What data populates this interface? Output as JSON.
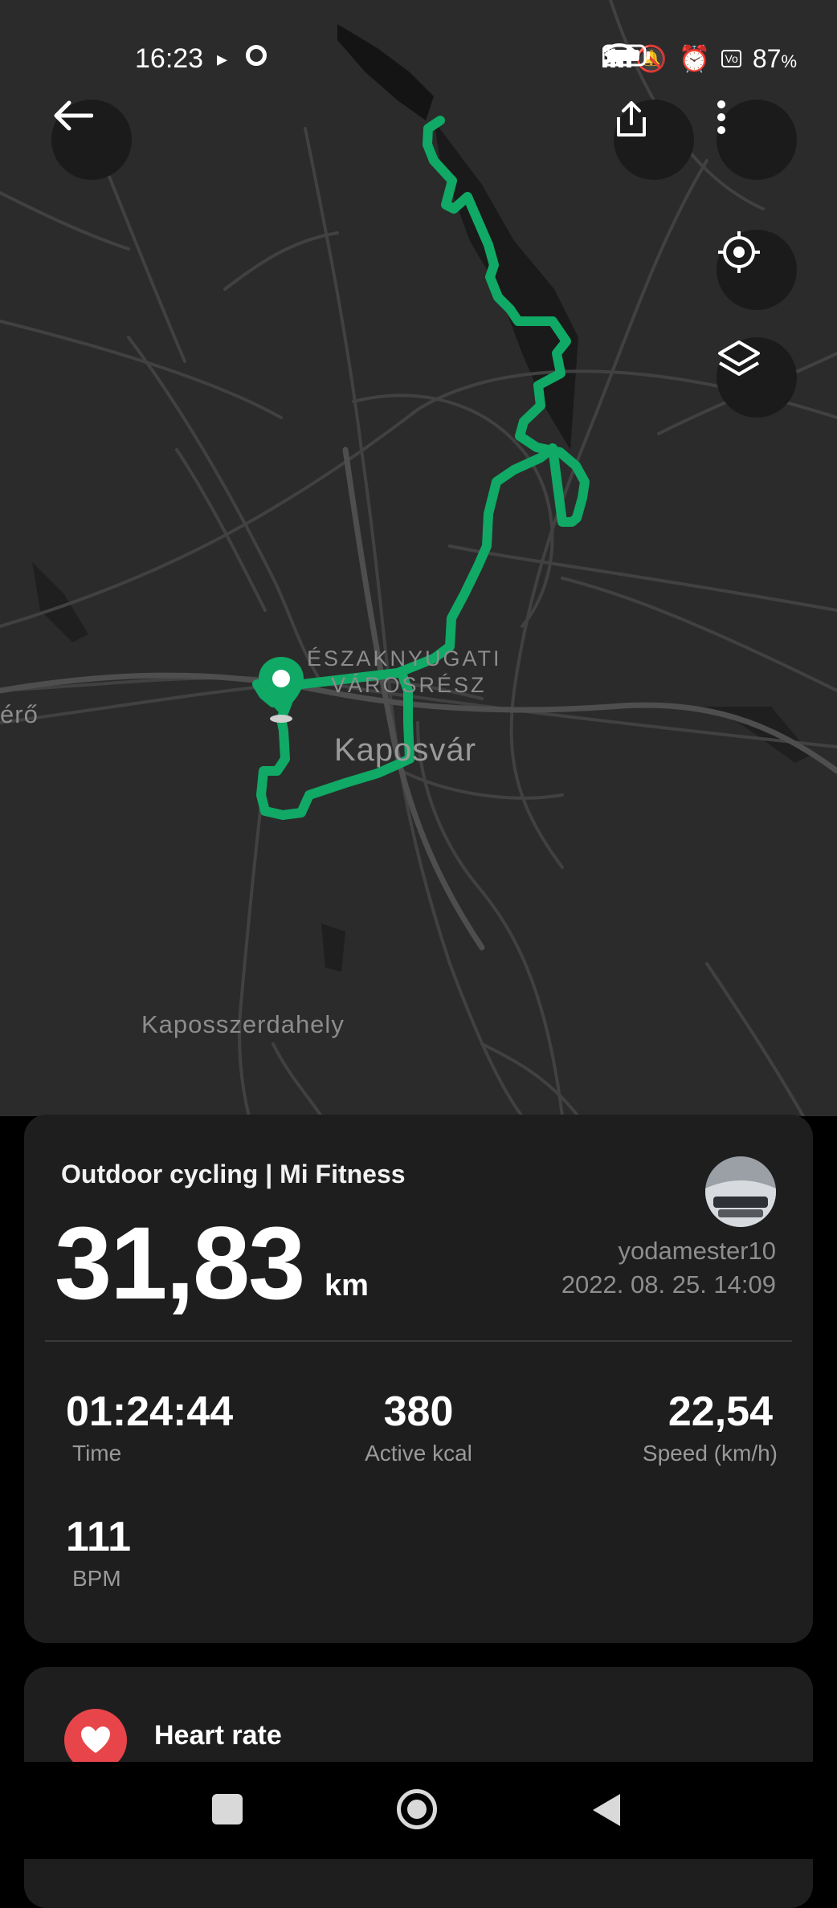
{
  "status_bar": {
    "time": "16:23",
    "battery": "87",
    "battery_unit": "%"
  },
  "map": {
    "labels": {
      "district_line1": "ÉSZAKNYUGATI",
      "district_line2": "VÁROSRÉSZ",
      "city": "Kaposvár",
      "village": "Kaposszerdahely",
      "left_edge": "érő"
    },
    "route_color": "#10a965"
  },
  "toolbar": {
    "back_icon": "arrow-left-icon",
    "share_icon": "share-icon",
    "more_icon": "more-vertical-icon",
    "locate_icon": "locate-target-icon",
    "layers_icon": "layers-icon"
  },
  "summary": {
    "title": "Outdoor cycling | Mi Fitness",
    "distance": "31,83",
    "distance_unit": "km",
    "username": "yodamester10",
    "datetime": "2022. 08. 25. 14:09",
    "stats": [
      {
        "value": "01:24:44",
        "label": "Time"
      },
      {
        "value": "380",
        "label": "Active kcal"
      },
      {
        "value": "22,54",
        "label": "Speed (km/h)"
      },
      {
        "value": "111",
        "label": "BPM"
      }
    ]
  },
  "heart_rate": {
    "title": "Heart rate",
    "icon": "heart-icon",
    "icon_color": "#e8454a"
  },
  "nav_bar": {
    "recents_icon": "square-icon",
    "home_icon": "circle-home-icon",
    "back_icon": "triangle-back-icon"
  }
}
